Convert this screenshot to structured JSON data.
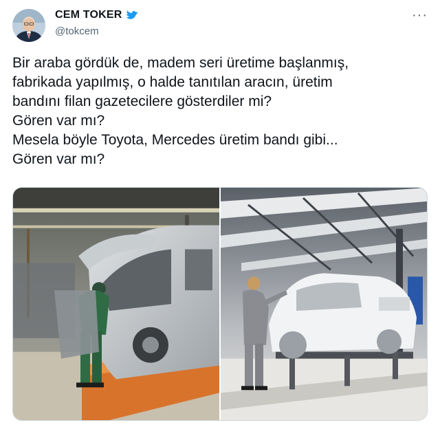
{
  "author": {
    "name": "CEM TOKER",
    "handle": "@tokcem",
    "verified_icon": "bird-badge-icon",
    "accent": "#1d9bf0"
  },
  "more_icon": "more-options-icon",
  "tweet": {
    "lines": [
      "Bir araba gördük de, madem seri üretime başlanmış,",
      "fabrikada yapılmış, o halde tanıtılan aracın, üretim",
      "bandını filan gazetecilere gösterdiler mi?",
      "Gören var mı?",
      "Mesela böyle Toyota, Mercedes üretim bandı gibi...",
      "Gören var mı?"
    ]
  },
  "media": [
    {
      "icon": "factory-photo-left"
    },
    {
      "icon": "factory-photo-right"
    }
  ]
}
